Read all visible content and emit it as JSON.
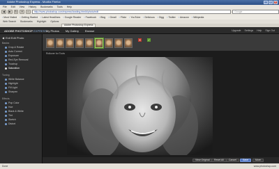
{
  "window": {
    "title": "Adobe Photoshop Express - Mozilla Firefox",
    "buttons": [
      "_",
      "□",
      "✕"
    ]
  },
  "menu": [
    "File",
    "Edit",
    "View",
    "History",
    "Bookmarks",
    "Tools",
    "Help"
  ],
  "address_bar": {
    "url": "http://www.photoshop.com/express/landing.html#/photo/edit",
    "search_placeholder": "Google"
  },
  "bookmarks": [
    "Most Visited",
    "Getting Started",
    "Latest Headlines",
    "Google Reader",
    "Facebook",
    "Blog",
    "Gmail",
    "Flickr",
    "YouTube",
    "Delicious",
    "Digg",
    "Twitter",
    "Amazon",
    "Wikipedia"
  ],
  "toolbar2": [
    "Web Search",
    "Bookmarks",
    "Highlight",
    "Options"
  ],
  "browser_tab": {
    "label": "Adobe Photoshop Express"
  },
  "app": {
    "logo": "ADOBE PHOTOSHOP",
    "logo_suffix": "EXPRESS",
    "nav": [
      "My Photos",
      "My Gallery",
      "Browse"
    ],
    "user_nav": [
      "Upgrade",
      "Settings",
      "Help",
      "Sign Out"
    ],
    "sidebar": {
      "back_label": "Exit Edit Photo",
      "sections": [
        {
          "title": "Basics",
          "tools": [
            {
              "label": "Crop & Rotate",
              "active": false
            },
            {
              "label": "Auto Correct",
              "active": false
            },
            {
              "label": "Exposure",
              "active": false
            },
            {
              "label": "Red-Eye Removal",
              "active": false
            },
            {
              "label": "Touchup",
              "active": false
            },
            {
              "label": "Saturation",
              "active": true
            }
          ]
        },
        {
          "title": "Tuning",
          "tools": [
            {
              "label": "White Balance",
              "active": false
            },
            {
              "label": "Highlight",
              "active": false
            },
            {
              "label": "Fill Light",
              "active": false
            },
            {
              "label": "Sharpen",
              "active": false
            }
          ]
        },
        {
          "title": "Effects",
          "tools": [
            {
              "label": "Pop Color",
              "active": false
            },
            {
              "label": "Hue",
              "active": false
            },
            {
              "label": "Black & White",
              "active": false
            },
            {
              "label": "Tint",
              "active": false
            },
            {
              "label": "Sketch",
              "active": false
            },
            {
              "label": "Distort",
              "active": false
            }
          ]
        }
      ]
    },
    "strip_tip": "Rollover for Tools",
    "bottom_buttons": [
      "View Original",
      "Reset All",
      "Cancel",
      "Save",
      "More"
    ],
    "photo_alt": "Black and white photo of a smiling child"
  },
  "status": {
    "left": "Done",
    "right": "www.photoshop.com"
  },
  "colors": {
    "accent": "#4f75c4",
    "app_bg": "#1c1c1c",
    "confirm": "#5c9b2e",
    "cancel": "#b9372b"
  }
}
